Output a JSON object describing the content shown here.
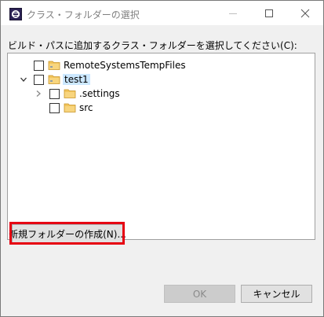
{
  "window": {
    "title": "クラス・フォルダーの選択"
  },
  "dialog": {
    "instruction": "ビルド・パスに追加するクラス・フォルダーを選択してください(C):"
  },
  "tree": {
    "items": [
      {
        "label": "RemoteSystemsTempFiles",
        "expanded": null,
        "checked": false,
        "selected": false
      },
      {
        "label": "test1",
        "expanded": true,
        "checked": false,
        "selected": true
      },
      {
        "label": ".settings",
        "expanded": false,
        "checked": false,
        "selected": false
      },
      {
        "label": "src",
        "expanded": null,
        "checked": false,
        "selected": false
      }
    ]
  },
  "buttons": {
    "new_folder": "新規フォルダーの作成(N)...",
    "ok": "OK",
    "cancel": "キャンセル"
  },
  "colors": {
    "highlight_border": "#e60012",
    "selection": "#cce8ff"
  }
}
